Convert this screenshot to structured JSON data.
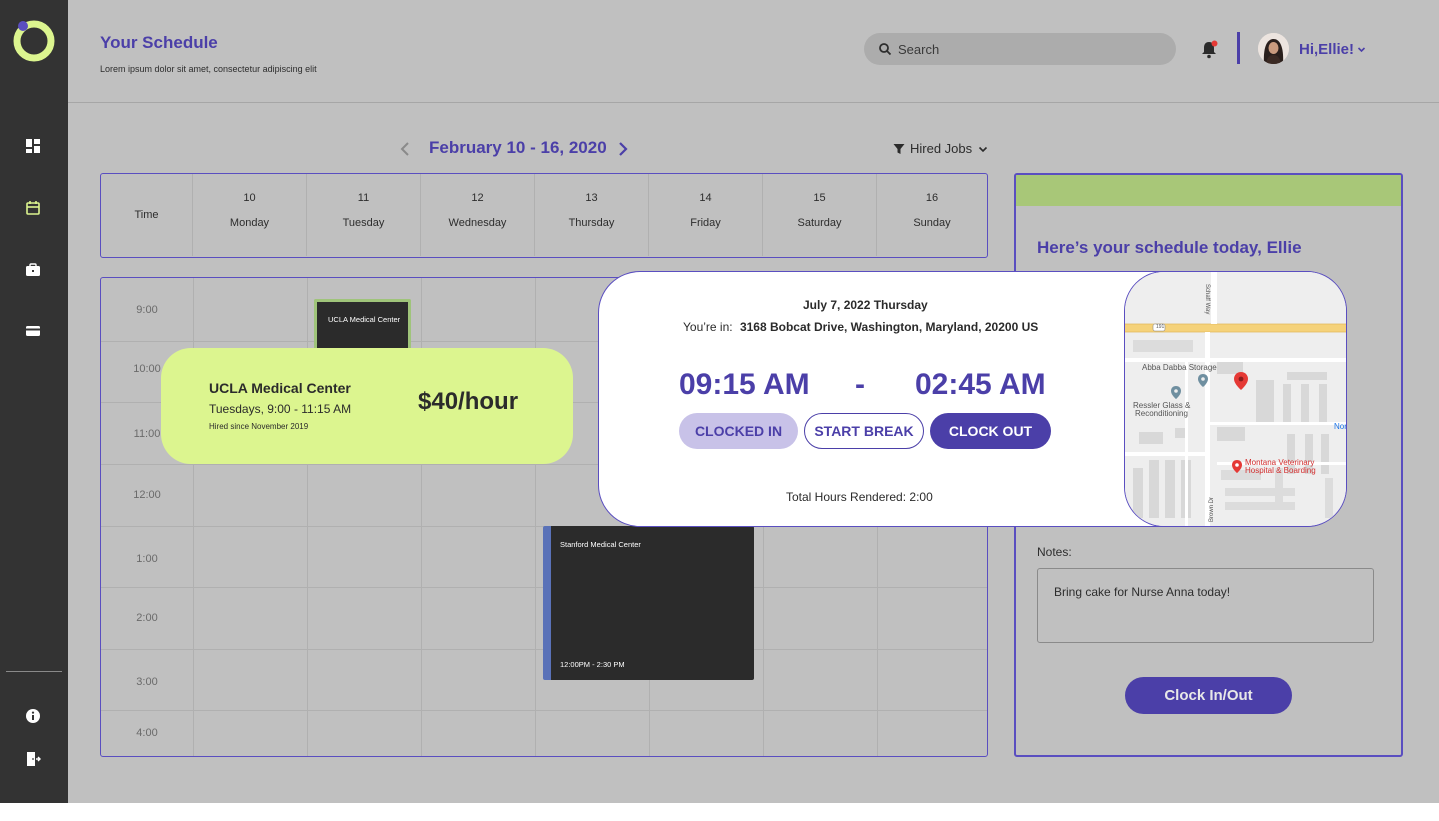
{
  "header": {
    "title": "Your Schedule",
    "subtitle": "Lorem ipsum dolor sit amet, consectetur adipiscing elit",
    "search_placeholder": "Search",
    "greeting": "Hi,Ellie!"
  },
  "sidebar": {
    "items": [
      {
        "name": "dashboard",
        "icon": "dashboard-icon"
      },
      {
        "name": "schedule",
        "icon": "calendar-icon",
        "active": true
      },
      {
        "name": "jobs",
        "icon": "briefcase-icon"
      },
      {
        "name": "payments",
        "icon": "credit-card-icon"
      }
    ],
    "bottom": [
      {
        "name": "info",
        "icon": "info-icon"
      },
      {
        "name": "logout",
        "icon": "logout-icon"
      }
    ]
  },
  "calendar": {
    "week_label": "February 10 - 16, 2020",
    "filter_label": "Hired Jobs",
    "time_header": "Time",
    "days": [
      {
        "num": "10",
        "name": "Monday"
      },
      {
        "num": "11",
        "name": "Tuesday"
      },
      {
        "num": "12",
        "name": "Wednesday"
      },
      {
        "num": "13",
        "name": "Thursday"
      },
      {
        "num": "14",
        "name": "Friday"
      },
      {
        "num": "15",
        "name": "Saturday"
      },
      {
        "num": "16",
        "name": "Sunday"
      }
    ],
    "times": [
      "9:00",
      "10:00",
      "11:00",
      "12:00",
      "1:00",
      "2:00",
      "3:00",
      "4:00"
    ],
    "events": {
      "ucla": {
        "title": "UCLA Medical Center"
      },
      "stanford": {
        "title": "Stanford Medical Center",
        "time": "12:00PM - 2:30 PM"
      }
    }
  },
  "job_card": {
    "title": "UCLA Medical Center",
    "schedule": "Tuesdays, 9:00 - 11:15 AM",
    "hired_since": "Hired since November 2019",
    "rate": "$40/hour"
  },
  "today_panel": {
    "title": "Here’s your schedule today, Ellie",
    "notes_label": "Notes:",
    "notes_text": "Bring cake for Nurse Anna today!",
    "clock_button": "Clock In/Out"
  },
  "clock_card": {
    "date": "July 7, 2022 Thursday",
    "location_prefix": "You’re in:",
    "location": "3168 Bobcat Drive, Washington, Maryland, 20200 US",
    "time_in": "09:15 AM",
    "separator": "-",
    "time_out": "02:45 AM",
    "clocked_in_label": "CLOCKED IN",
    "start_break_label": "START BREAK",
    "clock_out_label": "CLOCK OUT",
    "total_hours": "Total Hours Rendered: 2:00"
  },
  "map": {
    "labels": [
      "Schaff Way",
      "191",
      "Abba Dabba Storage",
      "Ressler Glass &",
      "Reconditioning",
      "Montana Veterinary",
      "Hospital & Boarding",
      "Brown Dr",
      "Nor"
    ]
  },
  "colors": {
    "primary": "#4b3fa8",
    "accent_green": "#dcf58f",
    "sidebar": "#333333",
    "background": "#c0c0c0"
  }
}
